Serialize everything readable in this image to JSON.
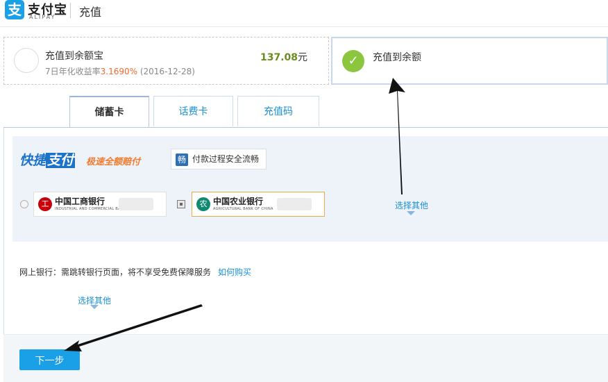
{
  "header": {
    "logo_symbol": "支",
    "logo_cn": "支付宝",
    "logo_en": "ALIPAY",
    "page_title": "充值"
  },
  "options": {
    "yuebao": {
      "title": "充值到余额宝",
      "rate_prefix": "7日年化收益率",
      "rate_value": "3.1690%",
      "rate_date": " (2016-12-28)",
      "amount": "137.08",
      "amount_unit": "元",
      "selected": false
    },
    "balance": {
      "title": "充值到余额",
      "check_icon": "✓",
      "selected": true
    }
  },
  "tabs": [
    {
      "label": "储蓄卡",
      "active": true
    },
    {
      "label": "话费卡",
      "active": false
    },
    {
      "label": "充值码",
      "active": false
    }
  ],
  "quickpay": {
    "brand_a": "快捷",
    "brand_b": "支付",
    "slogan": "极速全额赔付",
    "tip_icon": "畅",
    "tip_text": "付款过程安全流畅",
    "banks": [
      {
        "name": "中国工商银行",
        "name_en": "INDUSTRIAL AND COMMERCIAL BANK OF CHINA",
        "logo_icon": "工",
        "selected": false
      },
      {
        "name": "中国农业银行",
        "name_en": "AGRICULTURAL BANK OF CHINA",
        "logo_icon": "农",
        "selected": true
      }
    ],
    "select_other": "选择其他"
  },
  "netbank": {
    "label": "网上银行：",
    "desc": "需跳转银行页面，将不享受免费保障服务",
    "how_to_buy": "如何购买",
    "select_other": "选择其他"
  },
  "actions": {
    "next_label": "下一步"
  },
  "colors": {
    "brand_blue": "#1aa0e6",
    "link_blue": "#1a8fd4",
    "rate_orange": "#f2692b",
    "amount_green": "#6a8c1f",
    "check_green": "#8cc63f"
  }
}
